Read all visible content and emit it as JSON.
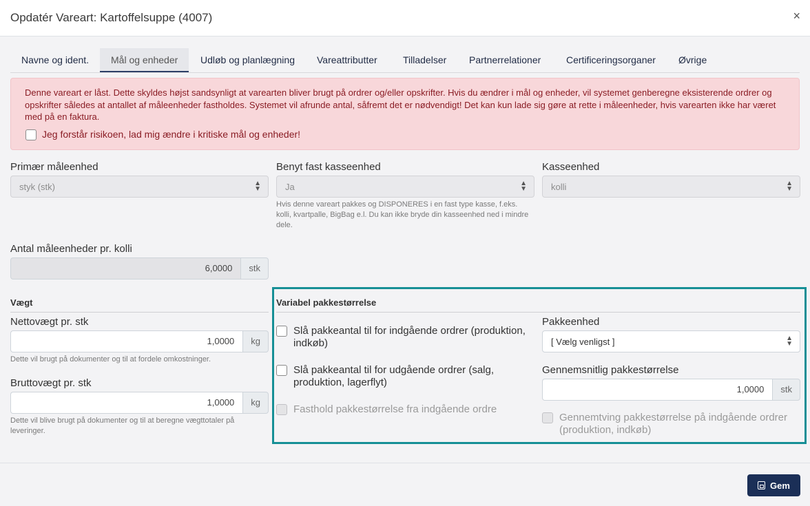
{
  "modal": {
    "title": "Opdatér Vareart: Kartoffelsuppe (4007)",
    "close": "×"
  },
  "tabs": [
    "Navne og ident.",
    "Mål og enheder",
    "Udløb og planlægning",
    "Vareattributter",
    "Tilladelser",
    "Partnerrelationer",
    "Certificeringsorganer",
    "Øvrige"
  ],
  "active_tab": "Mål og enheder",
  "alert": {
    "text": "Denne vareart er låst. Dette skyldes højst sandsynligt at varearten bliver brugt på ordrer og/eller opskrifter. Hvis du ændrer i mål og enheder, vil systemet genberegne eksisterende ordrer og opskrifter således at antallet af måleenheder fastholdes. Systemet vil afrunde antal, såfremt det er nødvendigt! Det kan kun lade sig gøre at rette i måleenheder, hvis varearten ikke har været med på en faktura.",
    "checkbox_label": "Jeg forstår risikoen, lad mig ændre i kritiske mål og enheder!"
  },
  "fields": {
    "primary_unit": {
      "label": "Primær måleenhed",
      "value": "styk (stk)"
    },
    "fixed_case": {
      "label": "Benyt fast kasseenhed",
      "value": "Ja",
      "help": "Hvis denne vareart pakkes og DISPONERES i en fast type kasse, f.eks. kolli, kvartpalle, BigBag e.l. Du kan ikke bryde din kasseenhed ned i mindre dele."
    },
    "case_unit": {
      "label": "Kasseenhed",
      "value": "kolli"
    },
    "units_per_case": {
      "label": "Antal måleenheder pr. kolli",
      "value": "6,0000",
      "unit": "stk"
    }
  },
  "weight": {
    "title": "Vægt",
    "net": {
      "label": "Nettovægt pr. stk",
      "value": "1,0000",
      "unit": "kg",
      "help": "Dette vil brugt på dokumenter og til at fordele omkostninger."
    },
    "gross": {
      "label": "Bruttovægt pr. stk",
      "value": "1,0000",
      "unit": "kg",
      "help": "Dette vil blive brugt på dokumenter og til at beregne vægttotaler på leveringer."
    }
  },
  "variable": {
    "title": "Variabel pakkestørrelse",
    "cb_inbound": "Slå pakkeantal til for indgående ordrer (produktion, indkøb)",
    "cb_outbound": "Slå pakkeantal til for udgående ordrer (salg, produktion, lagerflyt)",
    "cb_keep": "Fasthold pakkestørrelse fra indgående ordre",
    "pack_unit": {
      "label": "Pakkeenhed",
      "value": "[ Vælg venligst ]"
    },
    "avg_pack": {
      "label": "Gennemsnitlig pakkestørrelse",
      "value": "1,0000",
      "unit": "stk"
    },
    "cb_enforce": "Gennemtving pakkestørrelse på indgående ordrer (produktion, indkøb)"
  },
  "footer": {
    "save": "Gem"
  },
  "colors": {
    "primary": "#1b2f57",
    "highlight": "#168f96",
    "alert_bg": "#f8d7da",
    "alert_text": "#8a1c24"
  }
}
